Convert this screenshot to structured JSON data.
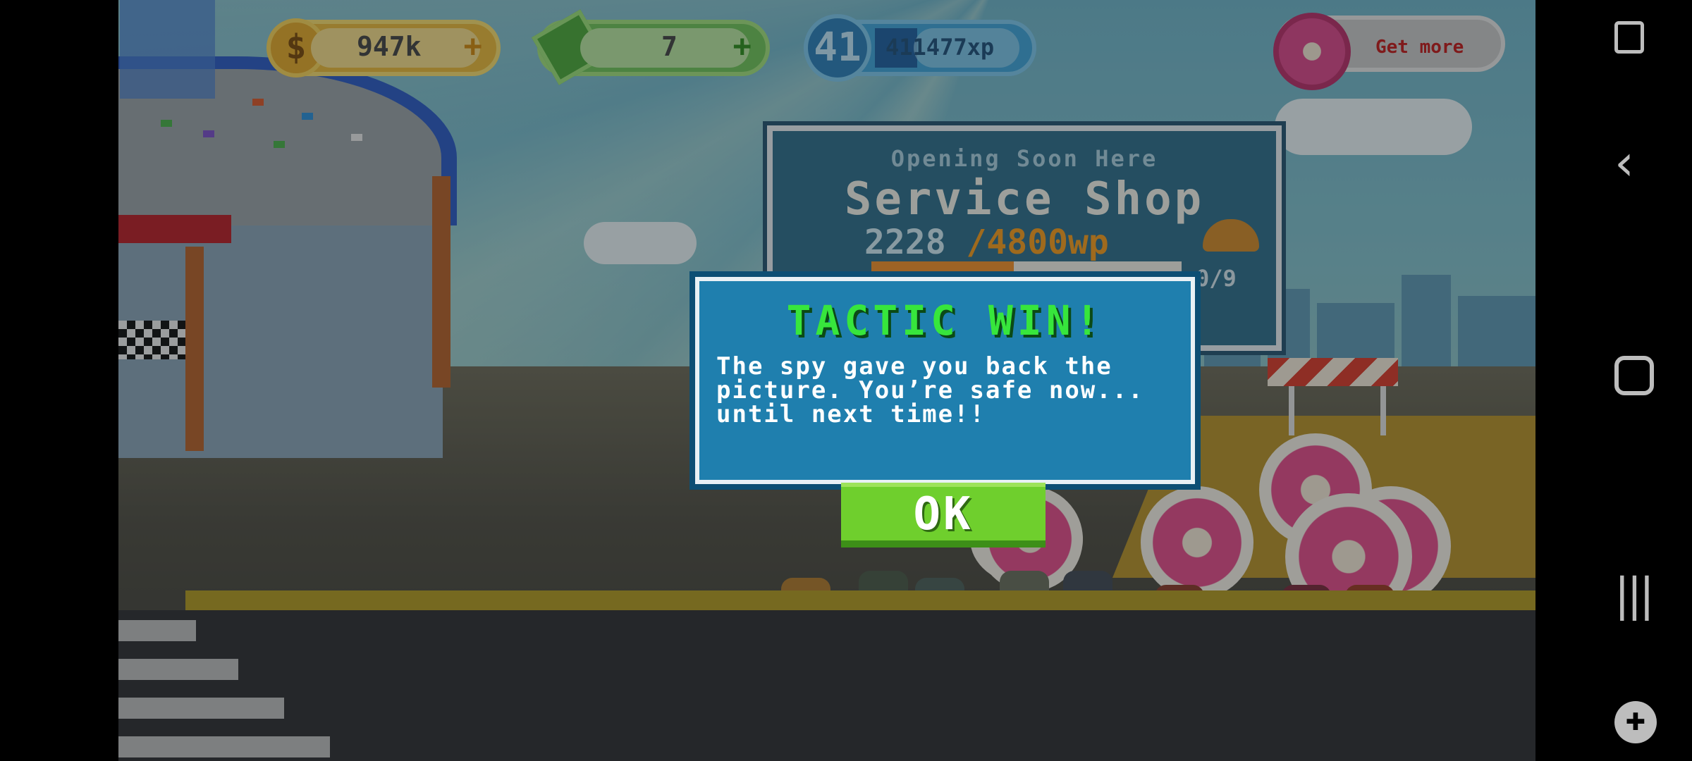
{
  "hud": {
    "coins": "947k",
    "cash": "7",
    "level": "41",
    "xp": "411477xp",
    "get_more": "Get more",
    "plus": "+"
  },
  "billboard": {
    "subtitle": "Opening Soon Here",
    "title": "Service Shop",
    "current": "2228",
    "goal": "/4800wp",
    "progress_fraction": 0.46,
    "count": "0/9"
  },
  "dialog": {
    "title": "TACTIC WIN!",
    "body": "The spy gave you back the picture. You’re safe now... until next time!!",
    "ok": "OK"
  },
  "colors": {
    "dialog_bg": "#1f7fae",
    "title_green": "#37e63c",
    "ok_green": "#6fcf2d"
  }
}
